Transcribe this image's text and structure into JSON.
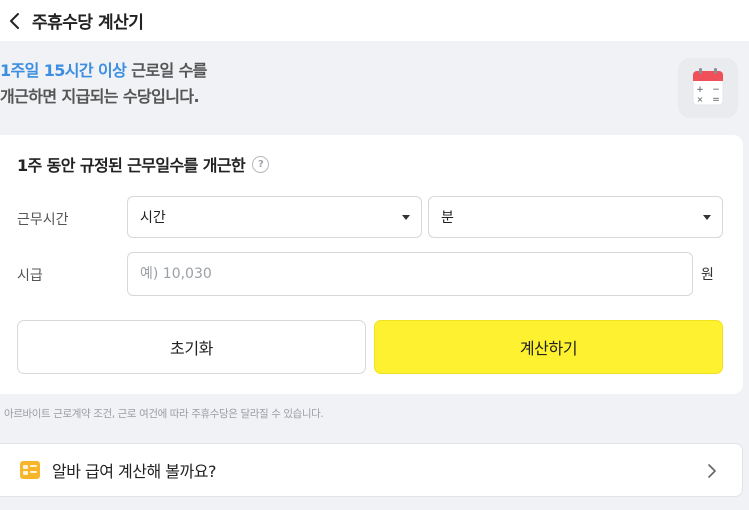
{
  "header": {
    "title": "주휴수당 계산기"
  },
  "intro": {
    "highlight": "1주일 15시간 이상",
    "line1_rest": " 근로일 수를",
    "line2": "개근하면 지급되는 수당입니다."
  },
  "form": {
    "title": "1주 동안 규정된 근무일수를 개근한",
    "help_symbol": "?",
    "work_time_label": "근무시간",
    "hour_select_value": "시간",
    "minute_select_value": "분",
    "wage_label": "시급",
    "wage_placeholder": "예) 10,030",
    "wage_value": "",
    "currency_unit": "원",
    "reset_label": "초기화",
    "calc_label": "계산하기"
  },
  "notice": "아르바이트 근로계약 조건, 근로 여건에 따라 주휴수당은 달라질 수 있습니다.",
  "banner": {
    "text": "알바 급여 계산해 볼까요?"
  },
  "colors": {
    "accent_blue": "#3b8ee0",
    "calc_button_yellow": "#fef230",
    "page_background": "#f1f2f5"
  },
  "icons": {
    "back": "chevron-left-icon",
    "calculator": "calculator-icon",
    "help": "question-circle-icon",
    "dropdown": "caret-down-icon",
    "banner": "wallet-icon",
    "banner_arrow": "chevron-right-icon"
  }
}
